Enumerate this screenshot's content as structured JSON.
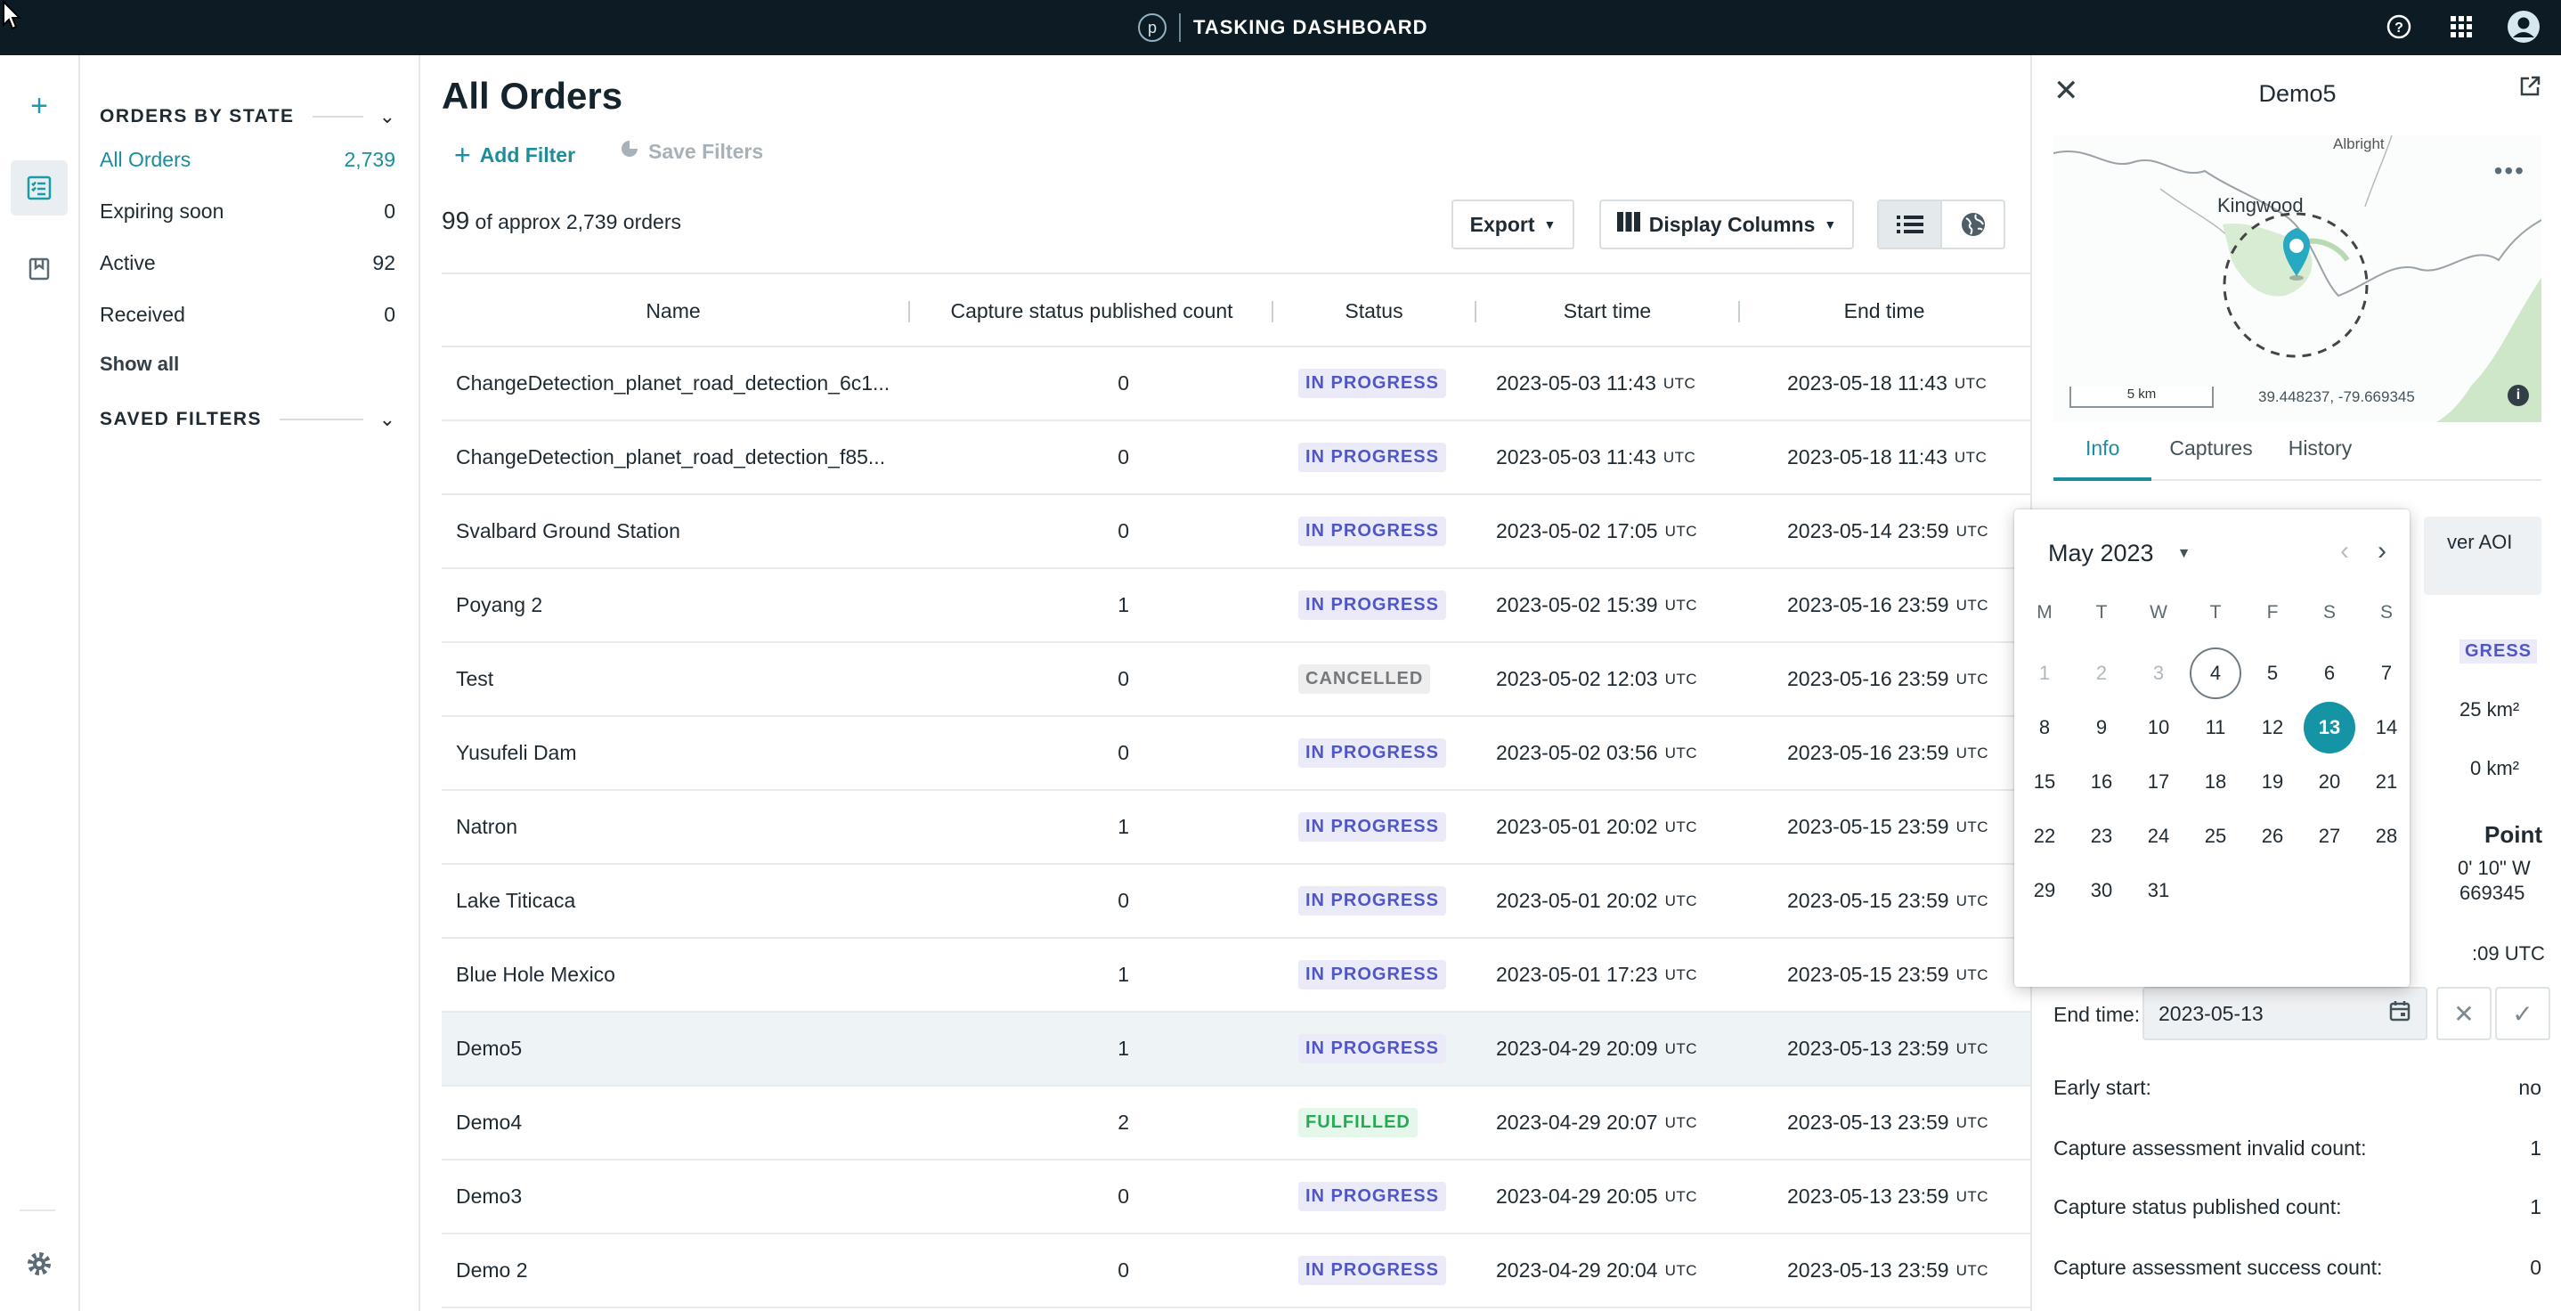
{
  "topbar": {
    "brand_letter": "p",
    "title": "TASKING DASHBOARD",
    "icons": [
      "help-icon",
      "apps-grid-icon",
      "account-icon"
    ]
  },
  "rail": {
    "icons": [
      "plus-icon",
      "orders-list-icon",
      "bookmark-icon",
      "gear-icon"
    ]
  },
  "sidebar": {
    "orders_by_state": "ORDERS BY STATE",
    "items": [
      {
        "label": "All Orders",
        "count": "2,739"
      },
      {
        "label": "Expiring soon",
        "count": "0"
      },
      {
        "label": "Active",
        "count": "92"
      },
      {
        "label": "Received",
        "count": "0"
      }
    ],
    "show_all": "Show all",
    "saved_filters": "SAVED FILTERS"
  },
  "main": {
    "title": "All Orders",
    "add_filter": "Add Filter",
    "save_filters": "Save Filters",
    "count_number": "99",
    "count_text": "of approx 2,739 orders",
    "export": "Export",
    "display_columns": "Display Columns"
  },
  "table": {
    "columns": [
      "Name",
      "Capture status published count",
      "Status",
      "Start time",
      "End time"
    ],
    "utc": "UTC",
    "rows": [
      {
        "name": "ChangeDetection_planet_road_detection_6c1...",
        "count": "0",
        "status": "IN PROGRESS",
        "start": "2023-05-03 11:43",
        "end": "2023-05-18 11:43"
      },
      {
        "name": "ChangeDetection_planet_road_detection_f85...",
        "count": "0",
        "status": "IN PROGRESS",
        "start": "2023-05-03 11:43",
        "end": "2023-05-18 11:43"
      },
      {
        "name": "Svalbard Ground Station",
        "count": "0",
        "status": "IN PROGRESS",
        "start": "2023-05-02 17:05",
        "end": "2023-05-14 23:59"
      },
      {
        "name": "Poyang 2",
        "count": "1",
        "status": "IN PROGRESS",
        "start": "2023-05-02 15:39",
        "end": "2023-05-16 23:59"
      },
      {
        "name": "Test",
        "count": "0",
        "status": "CANCELLED",
        "start": "2023-05-02 12:03",
        "end": "2023-05-16 23:59"
      },
      {
        "name": "Yusufeli Dam",
        "count": "0",
        "status": "IN PROGRESS",
        "start": "2023-05-02 03:56",
        "end": "2023-05-16 23:59"
      },
      {
        "name": "Natron",
        "count": "1",
        "status": "IN PROGRESS",
        "start": "2023-05-01 20:02",
        "end": "2023-05-15 23:59"
      },
      {
        "name": "Lake Titicaca",
        "count": "0",
        "status": "IN PROGRESS",
        "start": "2023-05-01 20:02",
        "end": "2023-05-15 23:59"
      },
      {
        "name": "Blue Hole Mexico",
        "count": "1",
        "status": "IN PROGRESS",
        "start": "2023-05-01 17:23",
        "end": "2023-05-15 23:59"
      },
      {
        "name": "Demo5",
        "count": "1",
        "status": "IN PROGRESS",
        "start": "2023-04-29 20:09",
        "end": "2023-05-13 23:59"
      },
      {
        "name": "Demo4",
        "count": "2",
        "status": "FULFILLED",
        "start": "2023-04-29 20:07",
        "end": "2023-05-13 23:59"
      },
      {
        "name": "Demo3",
        "count": "0",
        "status": "IN PROGRESS",
        "start": "2023-04-29 20:05",
        "end": "2023-05-13 23:59"
      },
      {
        "name": "Demo 2",
        "count": "0",
        "status": "IN PROGRESS",
        "start": "2023-04-29 20:04",
        "end": "2023-05-13 23:59"
      }
    ]
  },
  "panel": {
    "title": "Demo5",
    "map": {
      "place_top": "Albright",
      "place": "Kingwood",
      "scale": "5 km",
      "coords": "39.448237, -79.669345"
    },
    "tabs": [
      "Info",
      "Captures",
      "History"
    ],
    "fragments": {
      "aoi": "ver AOI",
      "status": "GRESS",
      "area1": "25 km²",
      "area2": "0 km²",
      "point": "Point",
      "lon": "0' 10\" W",
      "lon_dec": "669345",
      "time": ":09 UTC"
    },
    "end_time_label": "End time:",
    "end_time_value": "2023-05-13",
    "rows": [
      {
        "label": "Early start:",
        "value": "no"
      },
      {
        "label": "Capture assessment invalid count:",
        "value": "1"
      },
      {
        "label": "Capture status published count:",
        "value": "1"
      },
      {
        "label": "Capture assessment success count:",
        "value": "0"
      }
    ]
  },
  "datepicker": {
    "month": "May 2023",
    "weekdays": [
      "M",
      "T",
      "W",
      "T",
      "F",
      "S",
      "S"
    ],
    "weeks": [
      [
        "1",
        "2",
        "3",
        "4",
        "5",
        "6",
        "7"
      ],
      [
        "8",
        "9",
        "10",
        "11",
        "12",
        "13",
        "14"
      ],
      [
        "15",
        "16",
        "17",
        "18",
        "19",
        "20",
        "21"
      ],
      [
        "22",
        "23",
        "24",
        "25",
        "26",
        "27",
        "28"
      ],
      [
        "29",
        "30",
        "31"
      ]
    ],
    "disabled_days": [
      "1",
      "2",
      "3"
    ],
    "today": "4",
    "selected": "13"
  },
  "colors": {
    "accent": "#1b8e9d",
    "topbar": "#0d1c24",
    "in_progress": "#4f57c7",
    "fulfilled": "#27a955"
  }
}
